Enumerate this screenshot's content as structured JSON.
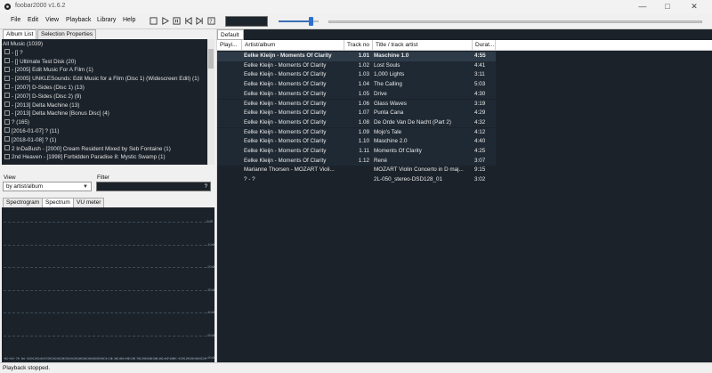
{
  "window": {
    "title": "foobar2000 v1.6.2"
  },
  "menu": [
    "File",
    "Edit",
    "View",
    "Playback",
    "Library",
    "Help"
  ],
  "toolbar": [
    "stop-icon",
    "play-icon",
    "pause-icon",
    "previous-icon",
    "next-icon",
    "random-icon"
  ],
  "volume": {
    "level": 0.8
  },
  "left_tabs": {
    "album_list": "Album List",
    "selection_properties": "Selection Properties"
  },
  "tree": [
    "All Music (1039)",
    "[] ?",
    "[] Ultimate Test Disk (20)",
    "[2005] Edit Music For A Film (1)",
    "[2005] UNKLESounds: Edit Music for a Film (Disc 1) (Widescreen Edit) (1)",
    "[2007] D-Sides (Disc 1) (13)",
    "[2007] D-Sides (Disc 2) (9)",
    "[2013] Delta Machine (13)",
    "[2013] Delta Machine [Bonus Disc] (4)",
    "? (165)",
    "[2016-01-07] ? (11)",
    "[2018-01-08] ? (1)",
    "2 InDaBush - [2000] Cream Resident Mixed by Seb Fontaine (1)",
    "2nd Heaven - [1998] Forbidden Paradise 8: Mystic Swamp (1)"
  ],
  "view": {
    "label": "View",
    "selected": "by artist/album"
  },
  "filter": {
    "label": "Filter",
    "value": "?"
  },
  "viz_tabs": {
    "spectrogram": "Spectrogram",
    "spectrum": "Spectrum",
    "vu": "VU meter"
  },
  "spectrum": {
    "db": [
      "0dB",
      "-10dB",
      "-20dB",
      "-30dB",
      "-40dB",
      "-50dB",
      "-60dB"
    ],
    "hz": [
      "50",
      "60",
      "70",
      "84",
      "100",
      "120",
      "140",
      "170",
      "200",
      "240",
      "280",
      "340",
      "400",
      "480",
      "560",
      "680",
      "800",
      "960",
      "1.1K",
      "1.3K",
      "1.6K",
      "1.9K",
      "2.2K",
      "2.7K",
      "3.2K",
      "3.8K",
      "4.5K",
      "5.4K",
      "6.4K",
      "7.6K",
      "9K",
      "10K",
      "12K",
      "15K",
      "18K",
      "22K"
    ]
  },
  "playlist_tab": "Default",
  "columns": {
    "playing": "Playi...",
    "artist": "Artist/album",
    "track": "Track no",
    "title": "Title / track artist",
    "duration": "Durat..."
  },
  "tracks": [
    {
      "artist": "Eelke Kleijn - Moments Of Clarity",
      "track": "1.01",
      "title": "Maschine 1.0",
      "duration": "4:55"
    },
    {
      "artist": "Eelke Kleijn - Moments Of Clarity",
      "track": "1.02",
      "title": "Lost Souls",
      "duration": "4:41"
    },
    {
      "artist": "Eelke Kleijn - Moments Of Clarity",
      "track": "1.03",
      "title": "1,000 Lights",
      "duration": "3:11"
    },
    {
      "artist": "Eelke Kleijn - Moments Of Clarity",
      "track": "1.04",
      "title": "The Calling",
      "duration": "5:03"
    },
    {
      "artist": "Eelke Kleijn - Moments Of Clarity",
      "track": "1.05",
      "title": "Drive",
      "duration": "4:30"
    },
    {
      "artist": "Eelke Kleijn - Moments Of Clarity",
      "track": "1.06",
      "title": "Glass Waves",
      "duration": "3:19"
    },
    {
      "artist": "Eelke Kleijn - Moments Of Clarity",
      "track": "1.07",
      "title": "Punta Cana",
      "duration": "4:29"
    },
    {
      "artist": "Eelke Kleijn - Moments Of Clarity",
      "track": "1.08",
      "title": "De Orde Van De Nacht (Part 2)",
      "duration": "4:32"
    },
    {
      "artist": "Eelke Kleijn - Moments Of Clarity",
      "track": "1.09",
      "title": "Mojo's Tale",
      "duration": "4:12"
    },
    {
      "artist": "Eelke Kleijn - Moments Of Clarity",
      "track": "1.10",
      "title": "Maschine 2.0",
      "duration": "4:40"
    },
    {
      "artist": "Eelke Kleijn - Moments Of Clarity",
      "track": "1.11",
      "title": "Moments Of Clarity",
      "duration": "4:25"
    },
    {
      "artist": "Eelke Kleijn - Moments Of Clarity",
      "track": "1.12",
      "title": "René",
      "duration": "3:07"
    },
    {
      "artist": "Marianne Thorsen - MOZART Violi...",
      "track": "",
      "title": "MOZART Violin Concerto in D maj...",
      "duration": "9:15"
    },
    {
      "artist": "? - ?",
      "track": "",
      "title": "2L-050_stereo-DSD128_01",
      "duration": "3:02"
    }
  ],
  "status": "Playback stopped."
}
